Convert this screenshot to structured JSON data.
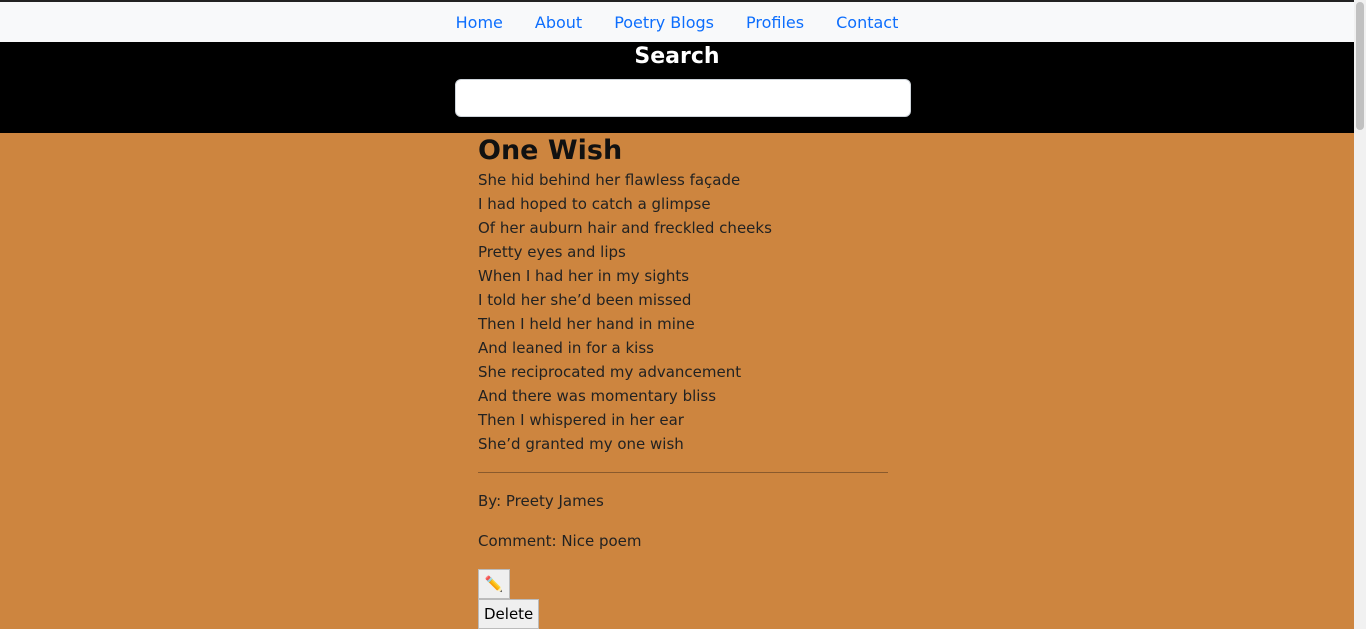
{
  "nav": {
    "items": [
      {
        "label": "Home"
      },
      {
        "label": "About"
      },
      {
        "label": "Poetry Blogs"
      },
      {
        "label": "Profiles"
      },
      {
        "label": "Contact"
      }
    ]
  },
  "search": {
    "title": "Search",
    "value": "",
    "placeholder": ""
  },
  "poem": {
    "title": "One Wish",
    "lines": [
      "She hid behind her flawless façade",
      "I had hoped to catch a glimpse",
      "Of her auburn hair and freckled cheeks",
      "Pretty eyes and lips",
      "When I had her in my sights",
      "I told her she’d been missed",
      "Then I held her hand in mine",
      "And leaned in for a kiss",
      "She reciprocated my advancement",
      "And there was momentary bliss",
      "Then I whispered in her ear",
      "She’d granted my one wish"
    ],
    "author": "By: Preety James",
    "comment": "Comment: Nice poem"
  },
  "actions": {
    "edit_icon": "✏️",
    "delete_label": "Delete"
  },
  "colors": {
    "page_background": "#cd853f",
    "search_band": "#000000",
    "nav_background": "#f8f9fa",
    "link": "#0d6efd"
  }
}
